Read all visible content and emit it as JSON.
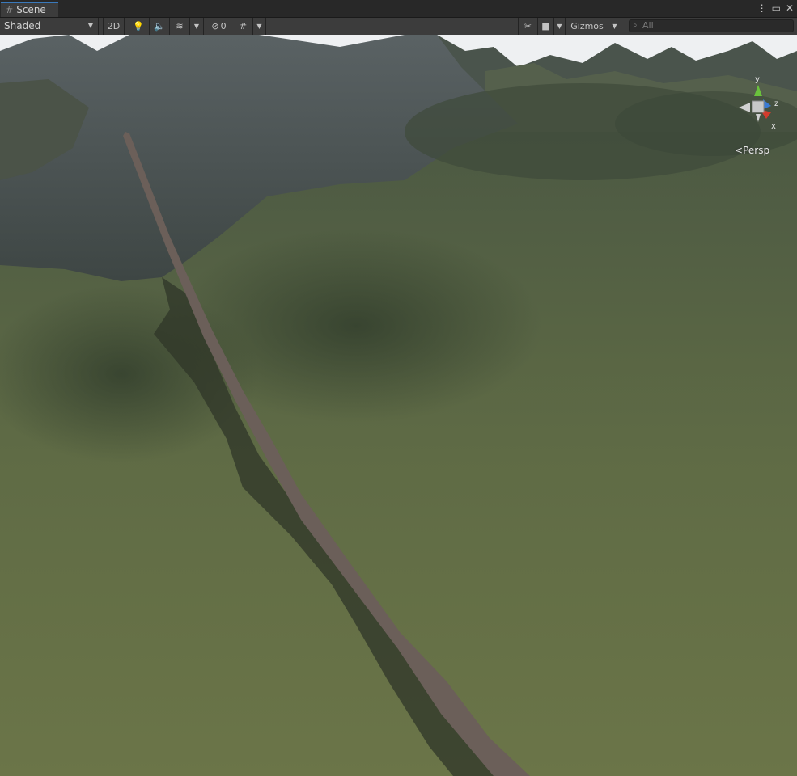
{
  "tab": {
    "label": "Scene"
  },
  "toolbar": {
    "draw_mode": "Shaded",
    "mode_2d": "2D",
    "hidden_count": "0",
    "gizmos": "Gizmos",
    "search_placeholder": "All"
  },
  "viewport": {
    "projection": "Persp",
    "axes": {
      "x": "x",
      "y": "y",
      "z": "z"
    }
  },
  "colors": {
    "accent": "#3a79bb",
    "terrain_grass": "#5c6a45",
    "terrain_rock": "#4a5050",
    "road": "#6b5f59",
    "axis_x": "#d23b2d",
    "axis_y": "#6ac23c",
    "axis_z": "#3a7bd5"
  }
}
